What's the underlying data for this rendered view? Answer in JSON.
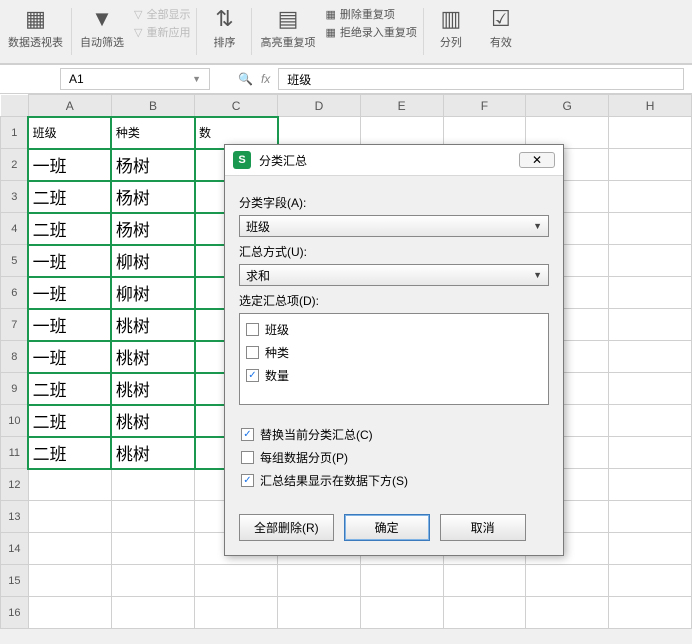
{
  "ribbon": {
    "pivot": "数据透视表",
    "autofilter": "自动筛选",
    "show_all": "全部显示",
    "reapply": "重新应用",
    "sort": "排序",
    "highlight_dup": "高亮重复项",
    "remove_dup": "删除重复项",
    "reject_dup": "拒绝录入重复项",
    "text_to_col": "分列",
    "validity": "有效"
  },
  "namebox": {
    "value": "A1"
  },
  "fx": "fx",
  "formula": "班级",
  "cols": [
    "A",
    "B",
    "C",
    "D",
    "E",
    "F",
    "G",
    "H"
  ],
  "rows": [
    "1",
    "2",
    "3",
    "4",
    "5",
    "6",
    "7",
    "8",
    "9",
    "10",
    "11",
    "12",
    "13",
    "14",
    "15",
    "16"
  ],
  "data": {
    "A1": "班级",
    "B1": "种类",
    "C1": "数",
    "A2": "一班",
    "B2": "杨树",
    "A3": "二班",
    "B3": "杨树",
    "A4": "二班",
    "B4": "杨树",
    "A5": "一班",
    "B5": "柳树",
    "A6": "一班",
    "B6": "柳树",
    "A7": "一班",
    "B7": "桃树",
    "A8": "一班",
    "B8": "桃树",
    "A9": "二班",
    "B9": "桃树",
    "A10": "二班",
    "B10": "桃树",
    "A11": "二班",
    "B11": "桃树"
  },
  "dialog": {
    "title": "分类汇总",
    "field_label": "分类字段(A):",
    "field_value": "班级",
    "method_label": "汇总方式(U):",
    "method_value": "求和",
    "items_label": "选定汇总项(D):",
    "item1": "班级",
    "item2": "种类",
    "item3": "数量",
    "opt1": "替换当前分类汇总(C)",
    "opt2": "每组数据分页(P)",
    "opt3": "汇总结果显示在数据下方(S)",
    "btn_delete": "全部删除(R)",
    "btn_ok": "确定",
    "btn_cancel": "取消",
    "close": "✕"
  }
}
